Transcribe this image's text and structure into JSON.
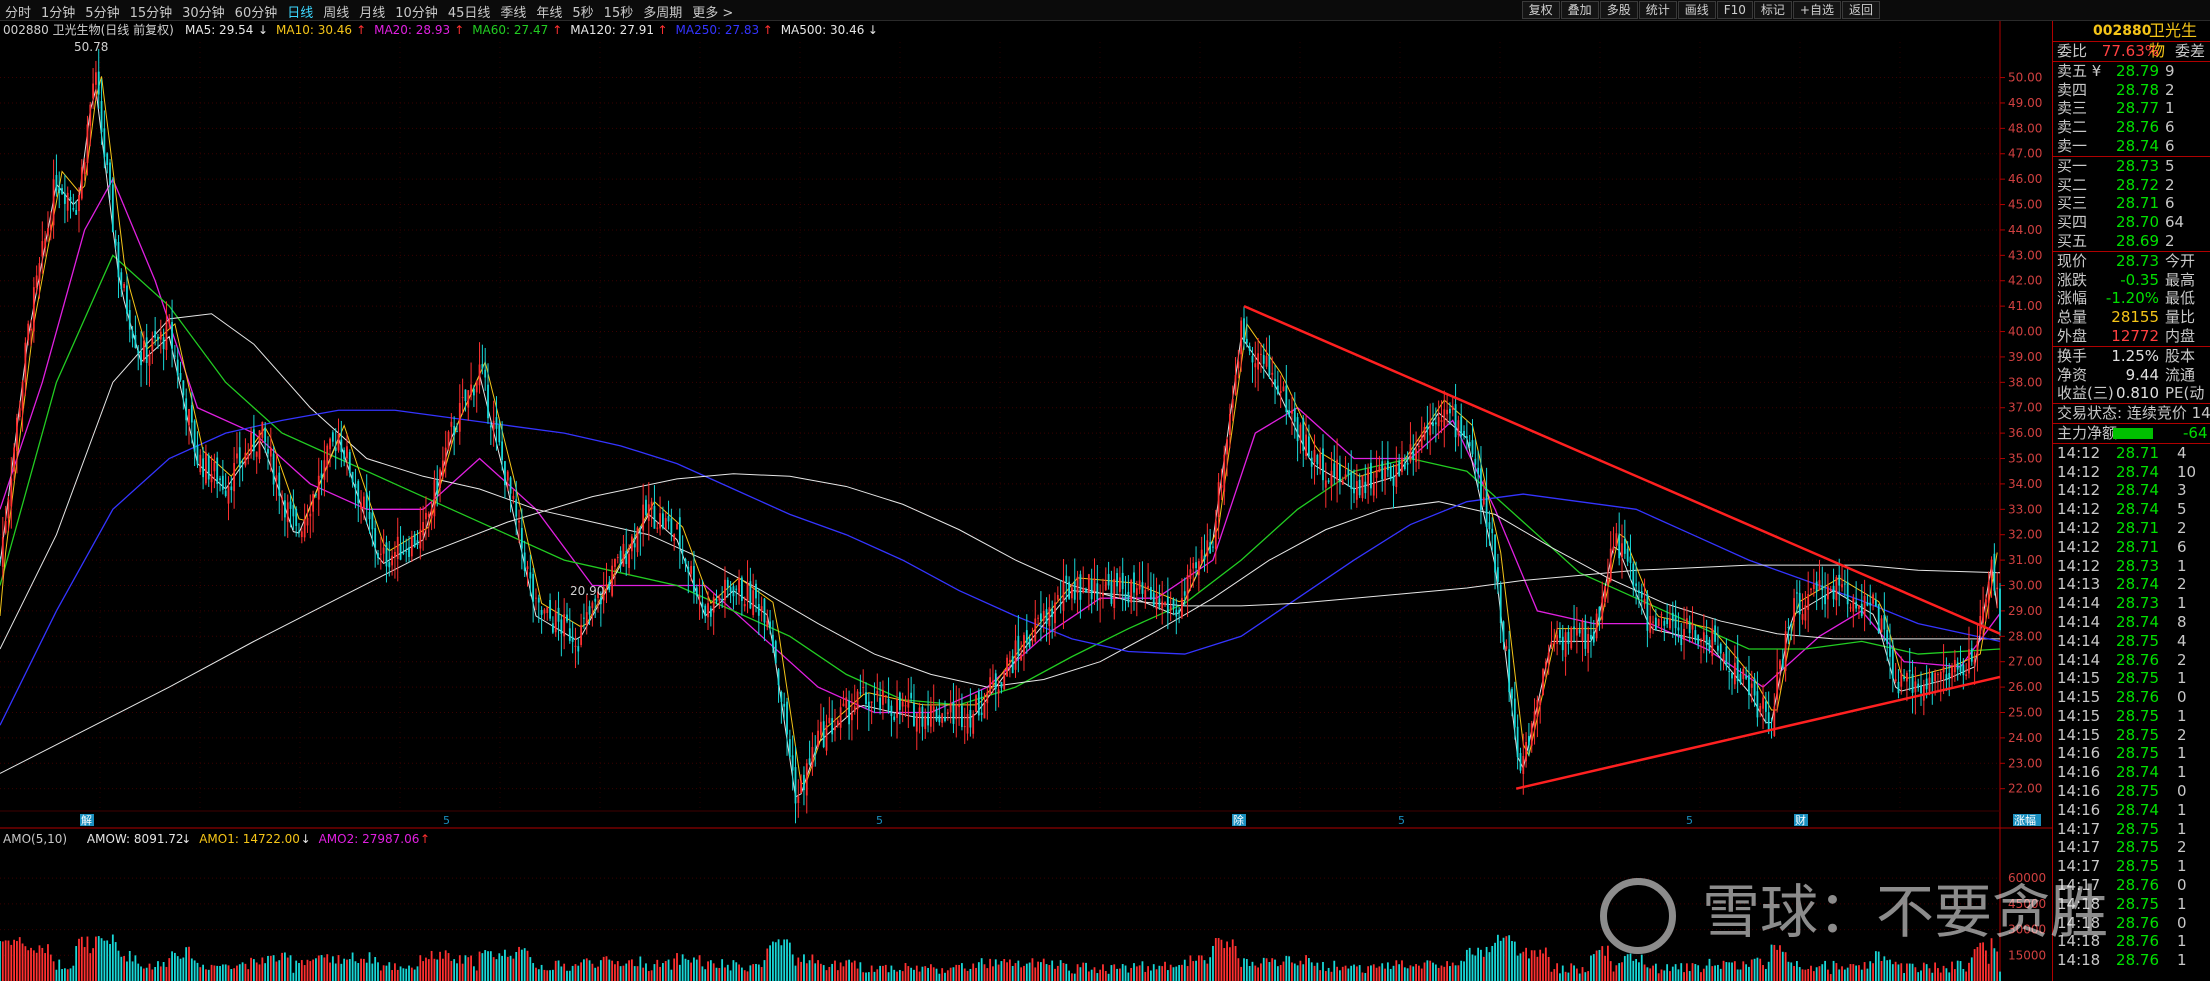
{
  "toolbar": {
    "periods": [
      "分时",
      "1分钟",
      "5分钟",
      "15分钟",
      "30分钟",
      "60分钟",
      "日线",
      "周线",
      "月线",
      "10分钟",
      "45日线",
      "季线",
      "年线",
      "5秒",
      "15秒",
      "多周期",
      "更多 >"
    ],
    "active_period": "日线",
    "tools": [
      "复权",
      "叠加",
      "多股",
      "统计",
      "画线",
      "F10",
      "标记",
      "+自选",
      "返回"
    ]
  },
  "legend_top": {
    "title": "002880 卫光生物(日线 前复权)",
    "items": [
      {
        "label": "MA5: 29.54",
        "arrow": "↓",
        "color": "#e6e6e6"
      },
      {
        "label": "MA10: 30.46",
        "arrow": "↑",
        "color": "#f5c518"
      },
      {
        "label": "MA20: 28.93",
        "arrow": "↑",
        "color": "#e020e0"
      },
      {
        "label": "MA60: 27.47",
        "arrow": "↑",
        "color": "#22cc22"
      },
      {
        "label": "MA120: 27.91",
        "arrow": "↑",
        "color": "#e6e6e6"
      },
      {
        "label": "MA250: 27.83",
        "arrow": "↑",
        "color": "#3434ff"
      },
      {
        "label": "MA500: 30.46",
        "arrow": "↓",
        "color": "#e6e6e6"
      }
    ]
  },
  "legend_vol": {
    "items": [
      {
        "label": "AMO(5,10)",
        "arrow": "",
        "color": "#c8c8c8"
      },
      {
        "label": "AMOW: 8091.72",
        "arrow": "↓",
        "color": "#e6e6e6"
      },
      {
        "label": "AMO1: 14722.00",
        "arrow": "↓",
        "color": "#f5c518"
      },
      {
        "label": "AMO2: 27987.06",
        "arrow": "↑",
        "color": "#e020e0"
      }
    ]
  },
  "annotations": {
    "high": "50.78",
    "low": "20.90",
    "markers": [
      "解",
      "5",
      "5",
      "除",
      "5",
      "5",
      "财",
      "涨幅"
    ]
  },
  "chart_data": {
    "type": "candlestick",
    "y_ticks": [
      "50.00",
      "49.00",
      "48.00",
      "47.00",
      "46.00",
      "45.00",
      "44.00",
      "43.00",
      "42.00",
      "41.00",
      "40.00",
      "39.00",
      "38.00",
      "37.00",
      "36.00",
      "35.00",
      "34.00",
      "33.00",
      "32.00",
      "31.00",
      "30.00",
      "29.00",
      "28.00",
      "27.00",
      "26.00",
      "25.00",
      "24.00",
      "23.00",
      "22.00"
    ],
    "ylim": [
      21.2,
      51.4
    ],
    "volume_ticks": [
      "60000",
      "45000",
      "30000",
      "15000"
    ],
    "close_path": [
      [
        0,
        31
      ],
      [
        20,
        40
      ],
      [
        40,
        46
      ],
      [
        55,
        45
      ],
      [
        67,
        50.2
      ],
      [
        85,
        42
      ],
      [
        100,
        39
      ],
      [
        120,
        40
      ],
      [
        140,
        35
      ],
      [
        160,
        34
      ],
      [
        185,
        36
      ],
      [
        210,
        32
      ],
      [
        240,
        36
      ],
      [
        270,
        31
      ],
      [
        300,
        32
      ],
      [
        320,
        36
      ],
      [
        340,
        38.5
      ],
      [
        360,
        34
      ],
      [
        380,
        29
      ],
      [
        410,
        28
      ],
      [
        440,
        31
      ],
      [
        460,
        33
      ],
      [
        480,
        32
      ],
      [
        500,
        29
      ],
      [
        520,
        30
      ],
      [
        545,
        29
      ],
      [
        565,
        21.5
      ],
      [
        580,
        24
      ],
      [
        610,
        25.5
      ],
      [
        650,
        25
      ],
      [
        690,
        25
      ],
      [
        730,
        28
      ],
      [
        760,
        30
      ],
      [
        800,
        29.8
      ],
      [
        835,
        29
      ],
      [
        860,
        32
      ],
      [
        880,
        40
      ],
      [
        905,
        38
      ],
      [
        930,
        35
      ],
      [
        960,
        34
      ],
      [
        990,
        34.5
      ],
      [
        1020,
        37
      ],
      [
        1040,
        36
      ],
      [
        1060,
        31
      ],
      [
        1078,
        22.5
      ],
      [
        1100,
        28
      ],
      [
        1130,
        28
      ],
      [
        1145,
        32
      ],
      [
        1170,
        28.5
      ],
      [
        1210,
        28
      ],
      [
        1240,
        26
      ],
      [
        1255,
        24.5
      ],
      [
        1270,
        29
      ],
      [
        1300,
        30
      ],
      [
        1330,
        29
      ],
      [
        1345,
        26
      ],
      [
        1380,
        26.5
      ],
      [
        1400,
        27
      ],
      [
        1412,
        31
      ],
      [
        1418,
        28.5
      ]
    ],
    "ma_lines": {
      "MA20": [
        [
          0,
          33
        ],
        [
          30,
          38
        ],
        [
          60,
          44
        ],
        [
          80,
          46
        ],
        [
          110,
          42
        ],
        [
          140,
          37
        ],
        [
          180,
          36
        ],
        [
          220,
          34
        ],
        [
          260,
          33
        ],
        [
          300,
          33
        ],
        [
          340,
          35
        ],
        [
          380,
          33
        ],
        [
          420,
          30
        ],
        [
          460,
          30
        ],
        [
          500,
          30
        ],
        [
          540,
          28
        ],
        [
          580,
          26
        ],
        [
          620,
          25
        ],
        [
          660,
          25
        ],
        [
          700,
          26
        ],
        [
          740,
          28
        ],
        [
          780,
          29.5
        ],
        [
          820,
          29.5
        ],
        [
          860,
          31
        ],
        [
          890,
          36
        ],
        [
          920,
          37
        ],
        [
          960,
          35
        ],
        [
          1000,
          35
        ],
        [
          1030,
          36.5
        ],
        [
          1060,
          33
        ],
        [
          1090,
          29
        ],
        [
          1130,
          28.5
        ],
        [
          1170,
          28.5
        ],
        [
          1210,
          27.5
        ],
        [
          1250,
          26
        ],
        [
          1290,
          28
        ],
        [
          1320,
          29
        ],
        [
          1350,
          27
        ],
        [
          1390,
          26.8
        ],
        [
          1418,
          28.9
        ]
      ],
      "MA60": [
        [
          0,
          30
        ],
        [
          40,
          38
        ],
        [
          80,
          43
        ],
        [
          120,
          41
        ],
        [
          160,
          38
        ],
        [
          200,
          36
        ],
        [
          240,
          35
        ],
        [
          280,
          34
        ],
        [
          320,
          33
        ],
        [
          360,
          32
        ],
        [
          400,
          31
        ],
        [
          440,
          30.5
        ],
        [
          480,
          30
        ],
        [
          520,
          29
        ],
        [
          560,
          28
        ],
        [
          600,
          26.5
        ],
        [
          640,
          25.5
        ],
        [
          680,
          25.3
        ],
        [
          720,
          26
        ],
        [
          760,
          27.2
        ],
        [
          800,
          28.3
        ],
        [
          840,
          29.3
        ],
        [
          880,
          31
        ],
        [
          920,
          33
        ],
        [
          960,
          34.5
        ],
        [
          1000,
          35
        ],
        [
          1040,
          34.5
        ],
        [
          1080,
          32.5
        ],
        [
          1120,
          30.5
        ],
        [
          1160,
          29.5
        ],
        [
          1200,
          28.5
        ],
        [
          1240,
          27.5
        ],
        [
          1280,
          27.5
        ],
        [
          1320,
          27.8
        ],
        [
          1360,
          27.3
        ],
        [
          1418,
          27.5
        ]
      ],
      "MA120": [
        [
          0,
          27.5
        ],
        [
          40,
          32
        ],
        [
          80,
          38
        ],
        [
          120,
          40.5
        ],
        [
          150,
          40.7
        ],
        [
          180,
          39.5
        ],
        [
          220,
          37
        ],
        [
          260,
          35
        ],
        [
          300,
          34.3
        ],
        [
          340,
          33.8
        ],
        [
          380,
          33
        ],
        [
          420,
          32.5
        ],
        [
          460,
          32
        ],
        [
          500,
          31
        ],
        [
          540,
          29.8
        ],
        [
          580,
          28.5
        ],
        [
          620,
          27.3
        ],
        [
          660,
          26.5
        ],
        [
          700,
          26
        ],
        [
          740,
          26.3
        ],
        [
          780,
          27
        ],
        [
          820,
          28.2
        ],
        [
          860,
          29.5
        ],
        [
          900,
          31
        ],
        [
          940,
          32.2
        ],
        [
          980,
          33
        ],
        [
          1020,
          33.3
        ],
        [
          1060,
          32.8
        ],
        [
          1100,
          31.5
        ],
        [
          1140,
          30.3
        ],
        [
          1180,
          29.3
        ],
        [
          1220,
          28.6
        ],
        [
          1260,
          28.1
        ],
        [
          1300,
          27.9
        ],
        [
          1340,
          27.9
        ],
        [
          1418,
          27.9
        ]
      ],
      "MA250": [
        [
          0,
          24.5
        ],
        [
          40,
          29
        ],
        [
          80,
          33
        ],
        [
          120,
          35
        ],
        [
          160,
          36
        ],
        [
          200,
          36.5
        ],
        [
          240,
          36.9
        ],
        [
          280,
          36.9
        ],
        [
          320,
          36.6
        ],
        [
          360,
          36.3
        ],
        [
          400,
          36
        ],
        [
          440,
          35.5
        ],
        [
          480,
          34.8
        ],
        [
          520,
          33.8
        ],
        [
          560,
          32.8
        ],
        [
          600,
          32
        ],
        [
          640,
          31
        ],
        [
          680,
          29.8
        ],
        [
          720,
          28.8
        ],
        [
          760,
          27.9
        ],
        [
          800,
          27.4
        ],
        [
          840,
          27.3
        ],
        [
          880,
          28
        ],
        [
          920,
          29.5
        ],
        [
          960,
          31
        ],
        [
          1000,
          32.4
        ],
        [
          1040,
          33.3
        ],
        [
          1080,
          33.6
        ],
        [
          1120,
          33.3
        ],
        [
          1160,
          33
        ],
        [
          1200,
          32
        ],
        [
          1240,
          31
        ],
        [
          1280,
          30.2
        ],
        [
          1320,
          29.4
        ],
        [
          1360,
          28.5
        ],
        [
          1418,
          27.8
        ]
      ],
      "MA500": [
        [
          0,
          22.6
        ],
        [
          60,
          24.3
        ],
        [
          120,
          26
        ],
        [
          180,
          27.8
        ],
        [
          240,
          29.5
        ],
        [
          300,
          31.2
        ],
        [
          360,
          32.5
        ],
        [
          420,
          33.5
        ],
        [
          480,
          34.2
        ],
        [
          520,
          34.4
        ],
        [
          560,
          34.3
        ],
        [
          600,
          33.9
        ],
        [
          640,
          33.2
        ],
        [
          680,
          32.2
        ],
        [
          720,
          31
        ],
        [
          760,
          30
        ],
        [
          800,
          29.4
        ],
        [
          840,
          29.2
        ],
        [
          880,
          29.2
        ],
        [
          920,
          29.3
        ],
        [
          960,
          29.5
        ],
        [
          1000,
          29.7
        ],
        [
          1040,
          29.9
        ],
        [
          1080,
          30.2
        ],
        [
          1120,
          30.4
        ],
        [
          1160,
          30.6
        ],
        [
          1200,
          30.7
        ],
        [
          1240,
          30.8
        ],
        [
          1280,
          30.8
        ],
        [
          1320,
          30.8
        ],
        [
          1360,
          30.6
        ],
        [
          1418,
          30.5
        ]
      ]
    },
    "trendlines": [
      [
        [
          882,
          41
        ],
        [
          1418,
          28.1
        ]
      ],
      [
        [
          1075,
          22
        ],
        [
          1418,
          26.4
        ]
      ]
    ]
  },
  "panel": {
    "code": "002880",
    "name": "卫光生物",
    "weibi": {
      "label": "委比",
      "value": "77.63%",
      "extra": "委差"
    },
    "asks": [
      {
        "label": "卖五 ¥",
        "price": "28.79",
        "vol": "9"
      },
      {
        "label": "卖四",
        "price": "28.78",
        "vol": "2"
      },
      {
        "label": "卖三",
        "price": "28.77",
        "vol": "1"
      },
      {
        "label": "卖二",
        "price": "28.76",
        "vol": "6"
      },
      {
        "label": "卖一",
        "price": "28.74",
        "vol": "6"
      }
    ],
    "bids": [
      {
        "label": "买一",
        "price": "28.73",
        "vol": "5"
      },
      {
        "label": "买二",
        "price": "28.72",
        "vol": "2"
      },
      {
        "label": "买三",
        "price": "28.71",
        "vol": "6"
      },
      {
        "label": "买四",
        "price": "28.70",
        "vol": "64"
      },
      {
        "label": "买五",
        "price": "28.69",
        "vol": "2"
      }
    ],
    "quote": [
      {
        "label": "现价",
        "value": "28.73",
        "extra": "今开",
        "cls": "g"
      },
      {
        "label": "涨跌",
        "value": "-0.35",
        "extra": "最高",
        "cls": "g"
      },
      {
        "label": "涨幅",
        "value": "-1.20%",
        "extra": "最低",
        "cls": "g"
      },
      {
        "label": "总量",
        "value": "28155",
        "extra": "量比",
        "cls": "y"
      },
      {
        "label": "外盘",
        "value": "12772",
        "extra": "内盘",
        "cls": ""
      }
    ],
    "fund": [
      {
        "label": "换手",
        "value": "1.25%",
        "extra": "股本"
      },
      {
        "label": "净资",
        "value": "9.44",
        "extra": "流通"
      },
      {
        "label": "收益(三)",
        "value": "0.810",
        "extra": "PE(动"
      }
    ],
    "status": "交易状态: 连续竞价 14",
    "flow_label": "主力净额",
    "flow_value": "-64",
    "ticks": [
      {
        "t": "14:12",
        "p": "28.71",
        "v": "4"
      },
      {
        "t": "14:12",
        "p": "28.74",
        "v": "10"
      },
      {
        "t": "14:12",
        "p": "28.74",
        "v": "3"
      },
      {
        "t": "14:12",
        "p": "28.74",
        "v": "5"
      },
      {
        "t": "14:12",
        "p": "28.71",
        "v": "2"
      },
      {
        "t": "14:12",
        "p": "28.71",
        "v": "6"
      },
      {
        "t": "14:12",
        "p": "28.73",
        "v": "1"
      },
      {
        "t": "14:13",
        "p": "28.74",
        "v": "2"
      },
      {
        "t": "14:14",
        "p": "28.73",
        "v": "1"
      },
      {
        "t": "14:14",
        "p": "28.74",
        "v": "8"
      },
      {
        "t": "14:14",
        "p": "28.75",
        "v": "4"
      },
      {
        "t": "14:14",
        "p": "28.76",
        "v": "2"
      },
      {
        "t": "14:15",
        "p": "28.75",
        "v": "1"
      },
      {
        "t": "14:15",
        "p": "28.76",
        "v": "0"
      },
      {
        "t": "14:15",
        "p": "28.75",
        "v": "1"
      },
      {
        "t": "14:15",
        "p": "28.75",
        "v": "2"
      },
      {
        "t": "14:16",
        "p": "28.75",
        "v": "1"
      },
      {
        "t": "14:16",
        "p": "28.74",
        "v": "1"
      },
      {
        "t": "14:16",
        "p": "28.75",
        "v": "0"
      },
      {
        "t": "14:16",
        "p": "28.74",
        "v": "1"
      },
      {
        "t": "14:17",
        "p": "28.75",
        "v": "1"
      },
      {
        "t": "14:17",
        "p": "28.75",
        "v": "2"
      },
      {
        "t": "14:17",
        "p": "28.75",
        "v": "1"
      },
      {
        "t": "14:17",
        "p": "28.76",
        "v": "0"
      },
      {
        "t": "14:18",
        "p": "28.75",
        "v": "1"
      },
      {
        "t": "14:18",
        "p": "28.76",
        "v": "0"
      },
      {
        "t": "14:18",
        "p": "28.76",
        "v": "1"
      },
      {
        "t": "14:18",
        "p": "28.76",
        "v": "1"
      }
    ]
  },
  "watermark": "雪球：不要贪胜"
}
